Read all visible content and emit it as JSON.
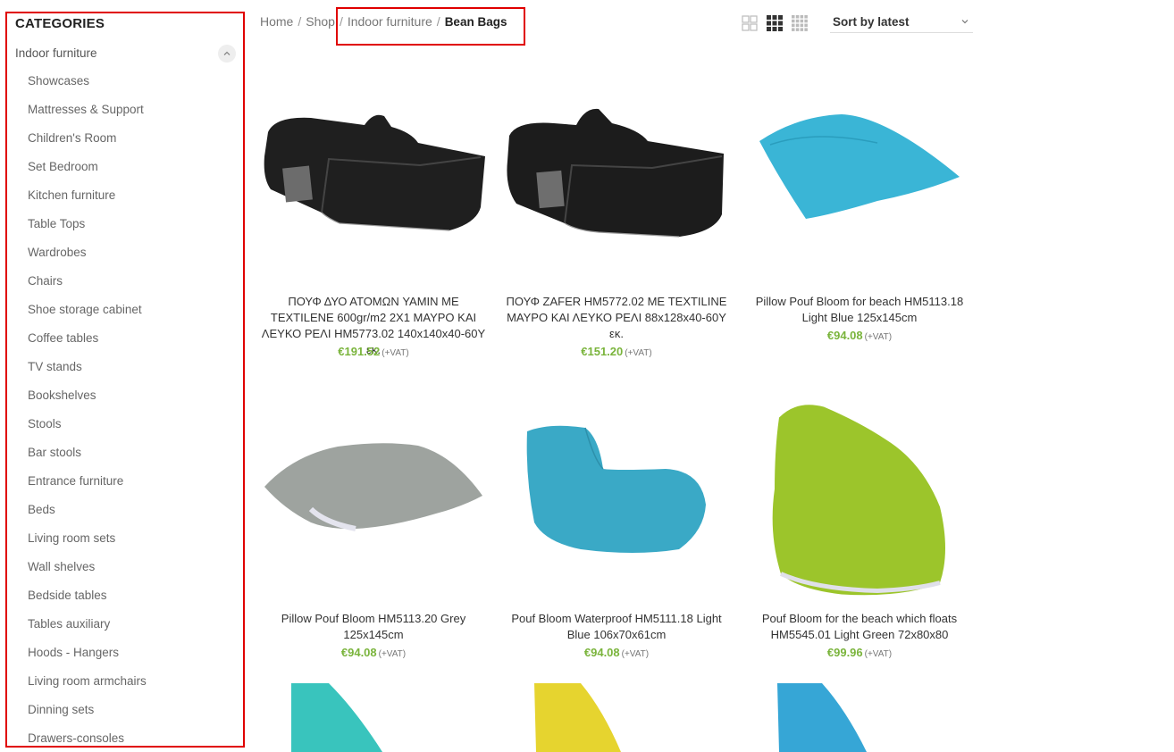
{
  "sidebar": {
    "title": "CATEGORIES",
    "parent": "Indoor furniture",
    "items": [
      "Showcases",
      "Mattresses & Support",
      "Children's Room",
      "Set Bedroom",
      "Kitchen furniture",
      "Table Tops",
      "Wardrobes",
      "Chairs",
      "Shoe storage cabinet",
      "Coffee tables",
      "TV stands",
      "Bookshelves",
      "Stools",
      "Bar stools",
      "Entrance furniture",
      "Beds",
      "Living room sets",
      "Wall shelves",
      "Bedside tables",
      "Tables auxiliary",
      "Hoods - Hangers",
      "Living room armchairs",
      "Dinning sets",
      "Drawers-consoles"
    ]
  },
  "breadcrumb": {
    "home": "Home",
    "shop": "Shop",
    "category": "Indoor furniture",
    "current": "Bean Bags",
    "separator": "/"
  },
  "toolbar": {
    "sort_label": "Sort by latest",
    "icons": [
      "grid-2-icon",
      "grid-3-icon",
      "grid-4-icon"
    ],
    "active_view": "grid-3"
  },
  "products": [
    {
      "name": "ΠΟΥΦ ΔΥΟ ΑΤΟΜΩΝ YAMIN ΜΕ TEXTILENE 600gr/m2 2Χ1 ΜΑΥΡΟ ΚΑΙ ΛΕΥΚΟ ΡΕΛΙ HM5773.02 140x140x40-60Υ εκ.",
      "price": "€191.52",
      "vat": "(+VAT)",
      "color": "#222222"
    },
    {
      "name": "ΠΟΥΦ ZAFER HM5772.02 ΜΕ TEXTILINE ΜΑΥΡΟ ΚΑΙ ΛΕΥΚΟ ΡΕΛΙ 88x128x40-60Υ εκ.",
      "price": "€151.20",
      "vat": "(+VAT)",
      "color": "#1f1f1f"
    },
    {
      "name": "Pillow Pouf Bloom for beach HM5113.18 Light Blue 125x145cm",
      "price": "€94.08",
      "vat": "(+VAT)",
      "color": "#3ab5d6"
    },
    {
      "name": "Pillow Pouf Bloom HM5113.20 Grey 125x145cm",
      "price": "€94.08",
      "vat": "(+VAT)",
      "color": "#9ea39f"
    },
    {
      "name": "Pouf Bloom Waterproof HM5111.18 Light Blue 106x70x61cm",
      "price": "€94.08",
      "vat": "(+VAT)",
      "color": "#3aa9c6"
    },
    {
      "name": "Pouf Bloom for the beach which floats HM5545.01 Light Green 72x80x80",
      "price": "€99.96",
      "vat": "(+VAT)",
      "color": "#9cc52b"
    }
  ],
  "partial_products": [
    {
      "color": "#39c4bd"
    },
    {
      "color": "#e6d42f"
    },
    {
      "color": "#36a6d6"
    }
  ]
}
